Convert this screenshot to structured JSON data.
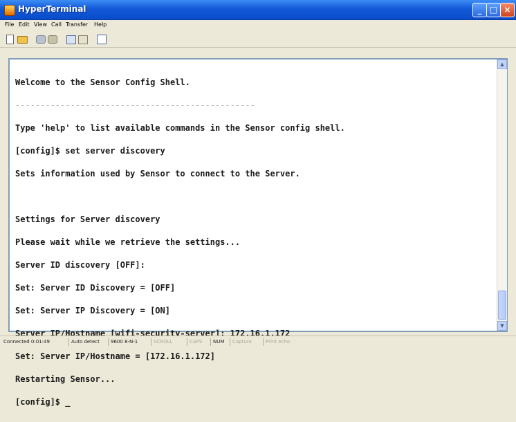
{
  "window": {
    "title": "HyperTerminal"
  },
  "menu": [
    "File",
    "Edit",
    "View",
    "Call",
    "Transfer",
    "Help"
  ],
  "toolbar": {
    "icons": [
      "new-icon",
      "open-icon",
      "connect-icon",
      "disconnect-icon",
      "send-icon",
      "receive-icon",
      "properties-icon"
    ]
  },
  "terminal": {
    "welcome": "Welcome to the Sensor Config Shell.",
    "rule": "------------------------------------------------",
    "lines": [
      "Type 'help' to list available commands in the Sensor config shell.",
      "[config]$ set server discovery",
      "Sets information used by Sensor to connect to the Server.",
      "",
      "Settings for Server discovery",
      "Please wait while we retrieve the settings...",
      "Server ID discovery [OFF]:",
      "Set: Server ID Discovery = [OFF]",
      "Set: Server IP Discovery = [ON]",
      "Server IP/Hostname [wifi-security-server]: 172.16.1.172",
      "Set: Server IP/Hostname = [172.16.1.172]",
      "Restarting Sensor...",
      "[config]$ _"
    ]
  },
  "status": {
    "connected": "Connected 0:01:49",
    "detect": "Auto detect",
    "baud": "9600 8-N-1",
    "scroll": "SCROLL",
    "caps": "CAPS",
    "num": "NUM",
    "capture": "Capture",
    "echo": "Print echo"
  }
}
